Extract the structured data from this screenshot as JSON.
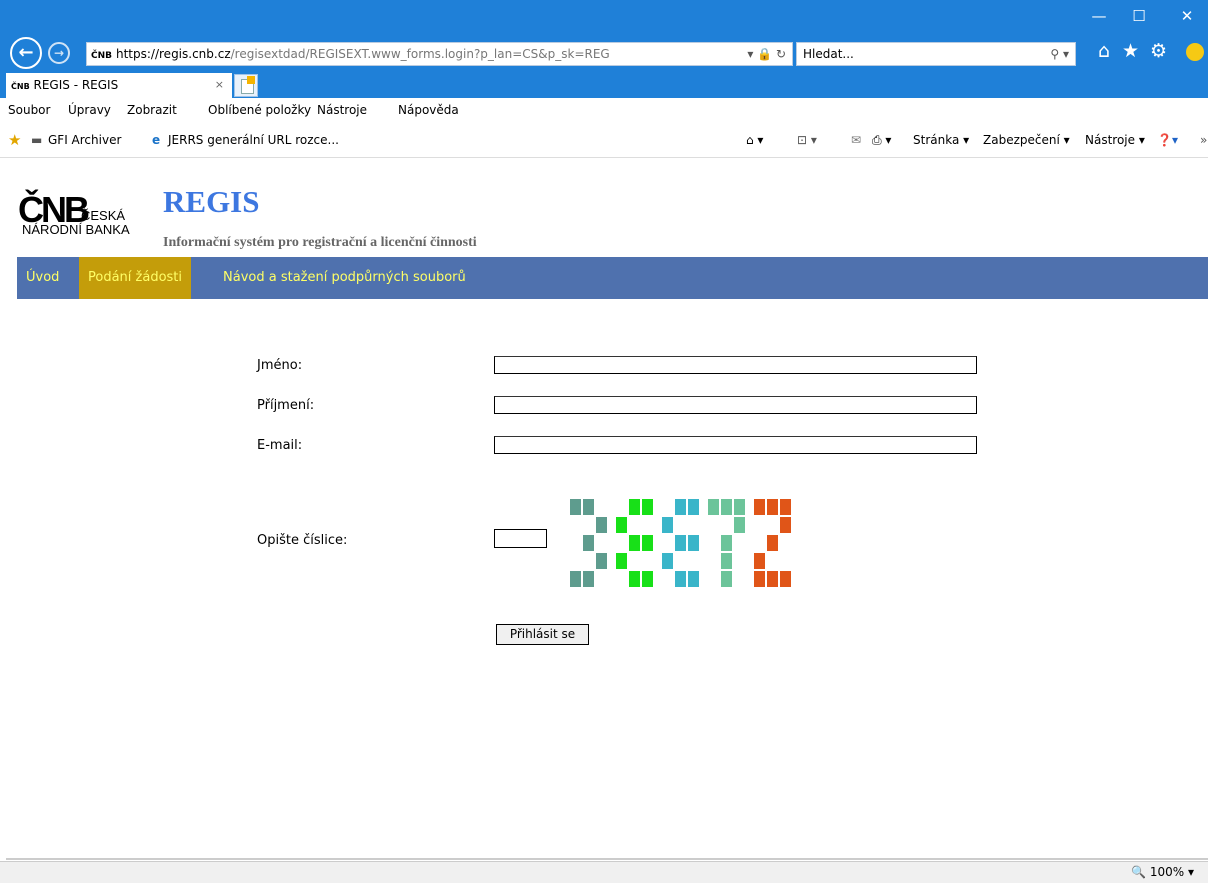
{
  "browser": {
    "window_controls": {
      "minimize": "—",
      "maximize": "☐",
      "close": "✕"
    },
    "address": {
      "favicon": "ČNB",
      "scheme": "https://",
      "domain": "regis.cnb.cz",
      "rest": "/regisextdad/REGISEXT.www_forms.login?p_lan=CS&p_sk=REG",
      "tools": "▾ 🔒 ↻"
    },
    "search": {
      "placeholder": "Hledat...",
      "icon": "⚲ ▾"
    },
    "toolbar_icons": {
      "home": "⌂",
      "favorites": "★",
      "settings": "⚙"
    },
    "tab": {
      "favicon": "ČNB",
      "title": "REGIS - REGIS",
      "close": "×"
    },
    "menu": [
      "Soubor",
      "Úpravy",
      "Zobrazit",
      "Oblíbené položky",
      "Nástroje",
      "Nápověda"
    ],
    "favorites": [
      {
        "icon": "★",
        "label": ""
      },
      {
        "icon": "▬",
        "label": "GFI Archiver"
      },
      {
        "icon": "e",
        "label": "JERRS generální URL rozce..."
      }
    ],
    "command_bar": {
      "home": "⌂ ▾",
      "feeds": "⊡ ▾",
      "mail": "✉",
      "print": "⎙ ▾",
      "page": "Stránka ▾",
      "security": "Zabezpečení ▾",
      "tools": "Nástroje ▾",
      "help": "❓▾",
      "more": "»"
    },
    "zoom": "🔍 100%  ▾"
  },
  "page": {
    "logo": {
      "cnb": "ČNB",
      "ceska": "ČESKÁ",
      "narodni": "NÁRODNÍ BANKA"
    },
    "title": "REGIS",
    "subtitle": "Informační systém pro registrační a licenční činnosti",
    "nav": [
      "Úvod",
      "Podání žádosti",
      "Návod a stažení podpůrných souborů"
    ],
    "form": {
      "first_name_label": "Jméno:",
      "first_name_value": "",
      "last_name_label": "Příjmení:",
      "last_name_value": "",
      "email_label": "E-mail:",
      "email_value": "",
      "captcha_label": "Opište číslice:",
      "captcha_value": "",
      "captcha_image": {
        "digits": [
          "3",
          "8",
          "8",
          "7",
          "2"
        ],
        "colors": [
          "#5e9c8e",
          "#18e018",
          "#3ab5c9",
          "#6cc49a",
          "#e05518"
        ]
      },
      "submit_label": "Přihlásit se"
    }
  }
}
